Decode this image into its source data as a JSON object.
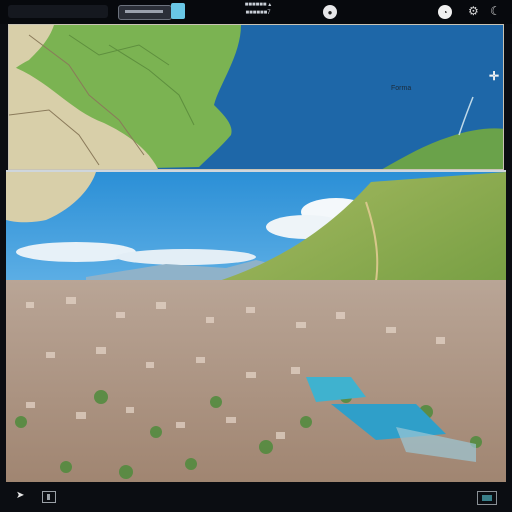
{
  "window": {
    "title_line1": "■■■■■■ ▴",
    "title_line2": "■■■■■■7"
  },
  "map": {
    "label": "Forma",
    "pin_glyph": "✛"
  },
  "toolbar": {
    "left_icon": "window-icon",
    "field_icon": "search-field",
    "square_icon": "panel-toggle-icon",
    "circle1_icon": "record-icon",
    "circle2_icon": "clock-icon",
    "right_glyph1": "⚙",
    "right_glyph2": "☾"
  },
  "bottom": {
    "cursor_glyph": "➤",
    "left_icon": "text-cursor-icon",
    "right_icon": "screen-icon"
  },
  "colors": {
    "sea": "#1e67a8",
    "land": "#7bb352",
    "sky": "#2b8fd6",
    "city": "#c9b3a3"
  }
}
